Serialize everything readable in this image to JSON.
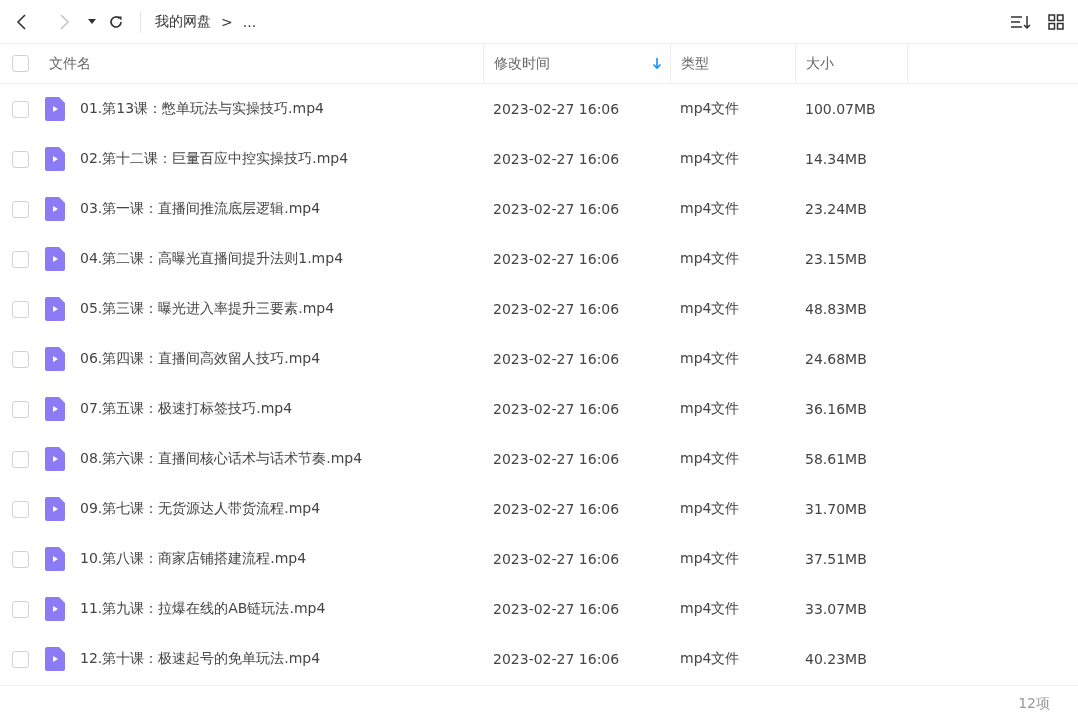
{
  "toolbar": {
    "back": {
      "disabled": false
    },
    "forward": {
      "disabled": true
    },
    "breadcrumb": [
      "我的网盘",
      ">",
      "..."
    ]
  },
  "table": {
    "select_all": {
      "checked": false
    },
    "columns": [
      {
        "label": "文件名",
        "sorted": false
      },
      {
        "label": "修改时间",
        "sorted": true
      },
      {
        "label": "类型",
        "sorted": false
      },
      {
        "label": "大小",
        "sorted": false
      }
    ],
    "rows": [
      {
        "name": "01.第13课：憋单玩法与实操技巧.mp4",
        "modified": "2023-02-27 16:06",
        "type": "mp4文件",
        "size": "100.07MB",
        "checked": false
      },
      {
        "name": "02.第十二课：巨量百应中控实操技巧.mp4",
        "modified": "2023-02-27 16:06",
        "type": "mp4文件",
        "size": "14.34MB",
        "checked": false
      },
      {
        "name": "03.第一课：直播间推流底层逻辑.mp4",
        "modified": "2023-02-27 16:06",
        "type": "mp4文件",
        "size": "23.24MB",
        "checked": false
      },
      {
        "name": "04.第二课：高曝光直播间提升法则1.mp4",
        "modified": "2023-02-27 16:06",
        "type": "mp4文件",
        "size": "23.15MB",
        "checked": false
      },
      {
        "name": "05.第三课：曝光进入率提升三要素.mp4",
        "modified": "2023-02-27 16:06",
        "type": "mp4文件",
        "size": "48.83MB",
        "checked": false
      },
      {
        "name": "06.第四课：直播间高效留人技巧.mp4",
        "modified": "2023-02-27 16:06",
        "type": "mp4文件",
        "size": "24.68MB",
        "checked": false
      },
      {
        "name": "07.第五课：极速打标签技巧.mp4",
        "modified": "2023-02-27 16:06",
        "type": "mp4文件",
        "size": "36.16MB",
        "checked": false
      },
      {
        "name": "08.第六课：直播间核心话术与话术节奏.mp4",
        "modified": "2023-02-27 16:06",
        "type": "mp4文件",
        "size": "58.61MB",
        "checked": false
      },
      {
        "name": "09.第七课：无货源达人带货流程.mp4",
        "modified": "2023-02-27 16:06",
        "type": "mp4文件",
        "size": "31.70MB",
        "checked": false
      },
      {
        "name": "10.第八课：商家店铺搭建流程.mp4",
        "modified": "2023-02-27 16:06",
        "type": "mp4文件",
        "size": "37.51MB",
        "checked": false
      },
      {
        "name": "11.第九课：拉爆在线的AB链玩法.mp4",
        "modified": "2023-02-27 16:06",
        "type": "mp4文件",
        "size": "33.07MB",
        "checked": false
      },
      {
        "name": "12.第十课：极速起号的免单玩法.mp4",
        "modified": "2023-02-27 16:06",
        "type": "mp4文件",
        "size": "40.23MB",
        "checked": false
      }
    ]
  },
  "status_bar": {
    "count": "12项"
  }
}
